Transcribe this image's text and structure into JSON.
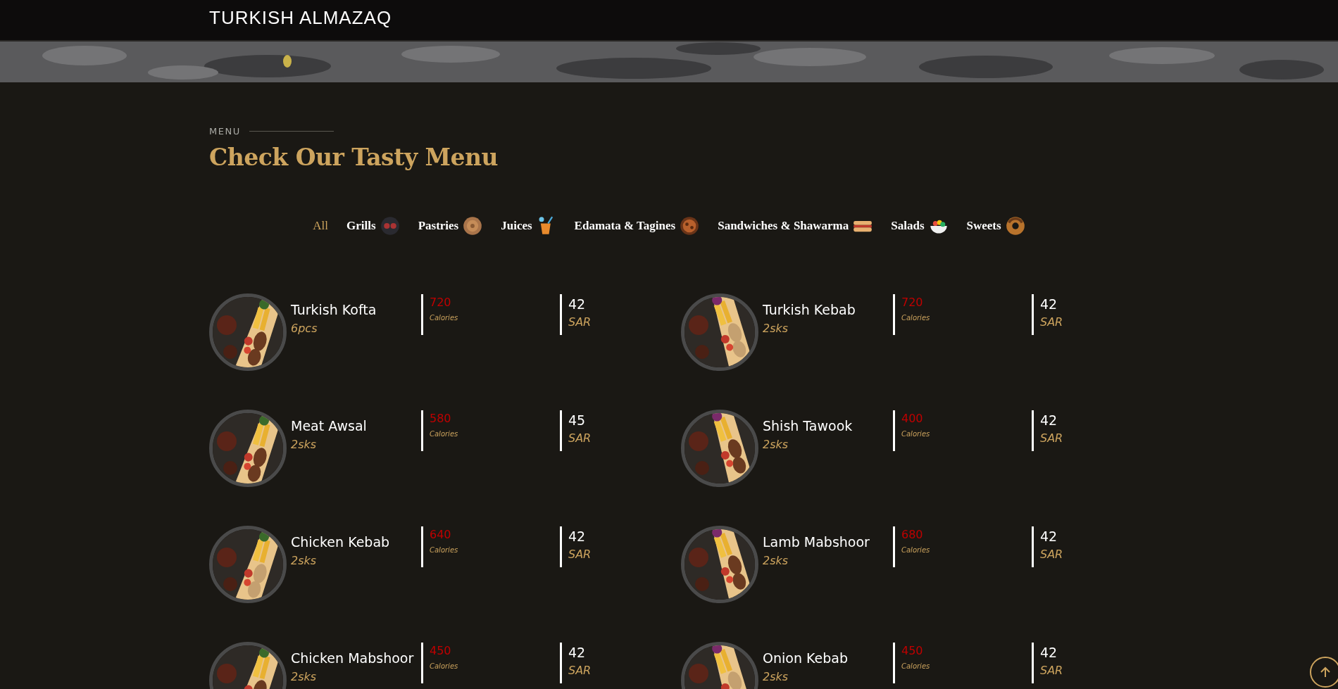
{
  "header": {
    "brand": "TURKISH ALMAZAQ"
  },
  "menu": {
    "label": "MENU",
    "title": "Check Our Tasty Menu",
    "filters": [
      {
        "label": "All",
        "selected": true
      },
      {
        "label": "Grills",
        "selected": false
      },
      {
        "label": "Pastries",
        "selected": false
      },
      {
        "label": "Juices",
        "selected": false
      },
      {
        "label": "Edamata & Tagines",
        "selected": false
      },
      {
        "label": "Sandwiches & Shawarma",
        "selected": false
      },
      {
        "label": "Salads",
        "selected": false
      },
      {
        "label": "Sweets",
        "selected": false
      }
    ],
    "items": [
      {
        "name": "Turkish Kofta",
        "detail": "6pcs",
        "calories": "720",
        "calories_label": "Calories",
        "price": "42",
        "currency": "SAR"
      },
      {
        "name": "Turkish Kebab",
        "detail": "2sks",
        "calories": "720",
        "calories_label": "Calories",
        "price": "42",
        "currency": "SAR"
      },
      {
        "name": "Meat Awsal",
        "detail": "2sks",
        "calories": "580",
        "calories_label": "Calories",
        "price": "45",
        "currency": "SAR"
      },
      {
        "name": "Shish Tawook",
        "detail": "2sks",
        "calories": "400",
        "calories_label": "Calories",
        "price": "42",
        "currency": "SAR"
      },
      {
        "name": "Chicken Kebab",
        "detail": "2sks",
        "calories": "640",
        "calories_label": "Calories",
        "price": "42",
        "currency": "SAR"
      },
      {
        "name": "Lamb Mabshoor",
        "detail": "2sks",
        "calories": "680",
        "calories_label": "Calories",
        "price": "42",
        "currency": "SAR"
      },
      {
        "name": "Chicken Mabshoor",
        "detail": "2sks",
        "calories": "450",
        "calories_label": "Calories",
        "price": "42",
        "currency": "SAR"
      },
      {
        "name": "Onion Kebab",
        "detail": "2sks",
        "calories": "450",
        "calories_label": "Calories",
        "price": "42",
        "currency": "SAR"
      }
    ]
  }
}
